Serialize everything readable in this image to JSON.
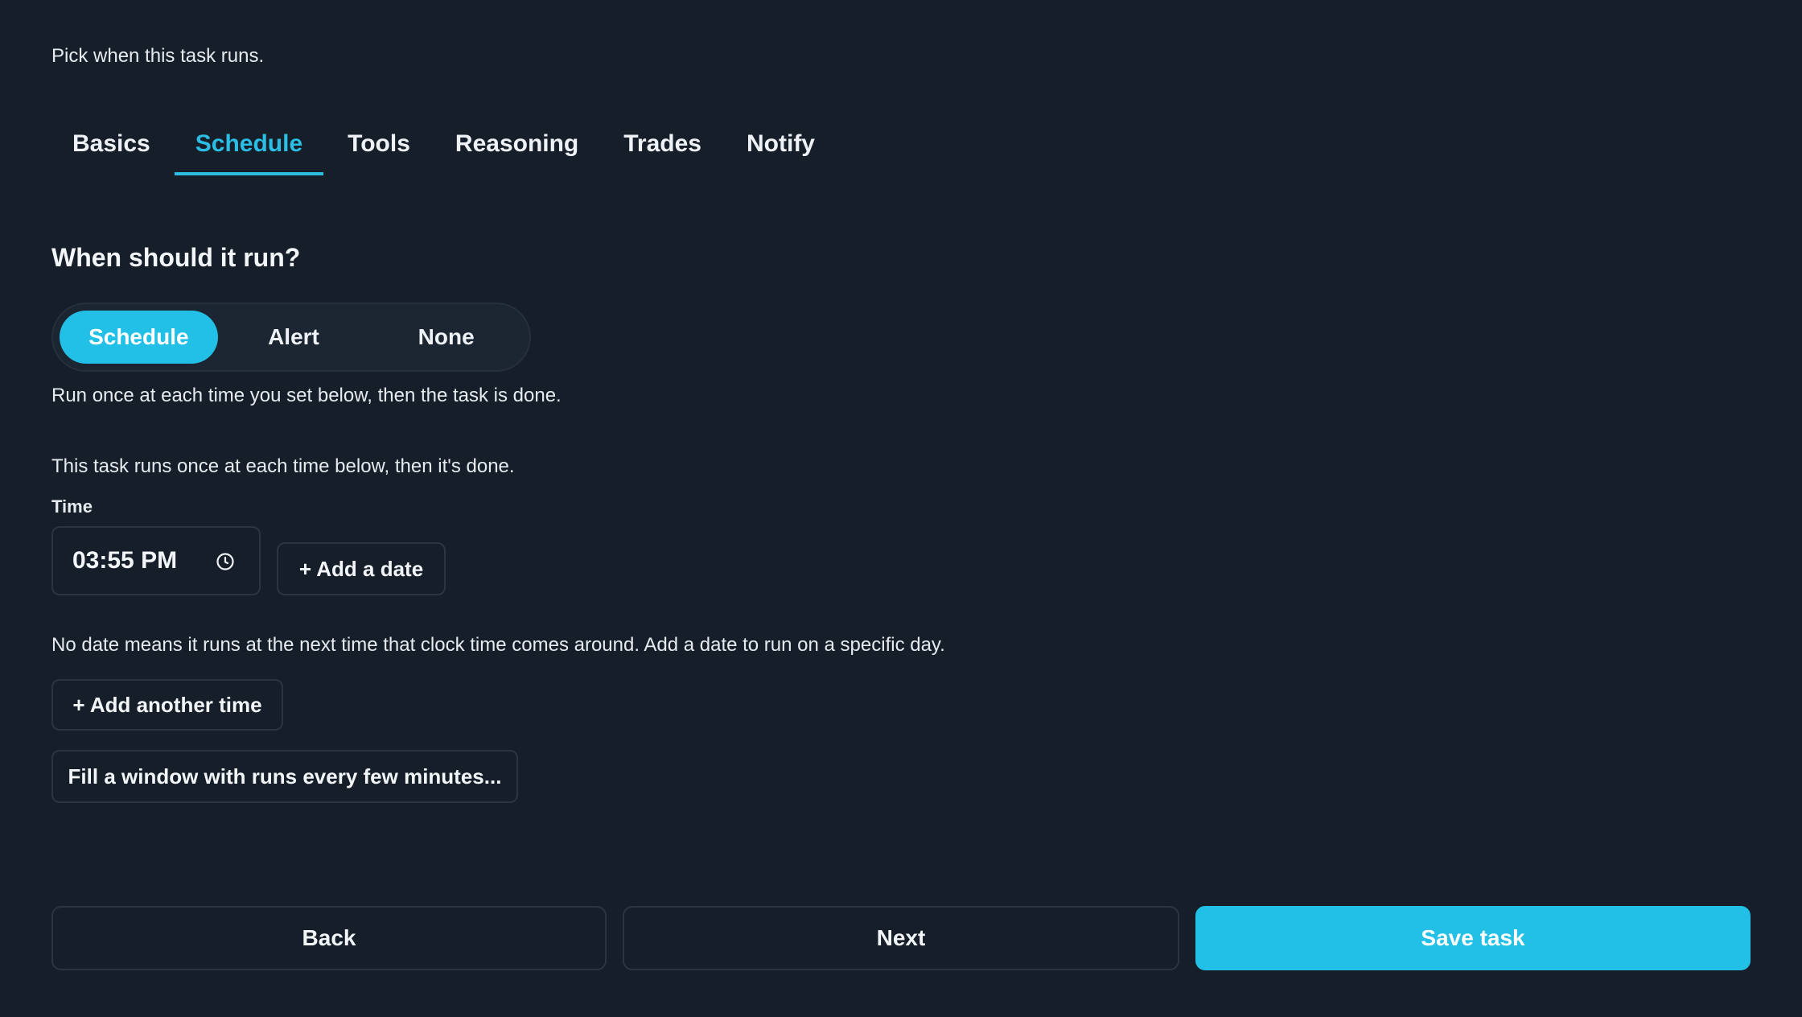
{
  "header": {
    "subtitle": "Pick when this task runs."
  },
  "tabs": [
    {
      "label": "Basics",
      "active": false
    },
    {
      "label": "Schedule",
      "active": true
    },
    {
      "label": "Tools",
      "active": false
    },
    {
      "label": "Reasoning",
      "active": false
    },
    {
      "label": "Trades",
      "active": false
    },
    {
      "label": "Notify",
      "active": false
    }
  ],
  "trigger": {
    "title": "When should it run?",
    "options": [
      "Schedule",
      "Alert",
      "None"
    ],
    "selected": "Schedule",
    "description": "Run once at each time you set below, then the task is done."
  },
  "schedule": {
    "info": "This task runs once at each time below, then it's done.",
    "time_label": "Time",
    "time_value": "03:55 PM",
    "time_icon": "clock-icon",
    "add_date_label": "+ Add a date",
    "hint": "No date means it runs at the next time that clock time comes around. Add a date to run on a specific day.",
    "add_time_label": "+ Add another time",
    "fill_window_label": "Fill a window with runs every few minutes..."
  },
  "footer": {
    "back_label": "Back",
    "next_label": "Next",
    "save_label": "Save task"
  },
  "colors": {
    "background": "#161f29",
    "accent": "#22bfe6",
    "border": "#2a3541",
    "text": "#eef2f6"
  }
}
